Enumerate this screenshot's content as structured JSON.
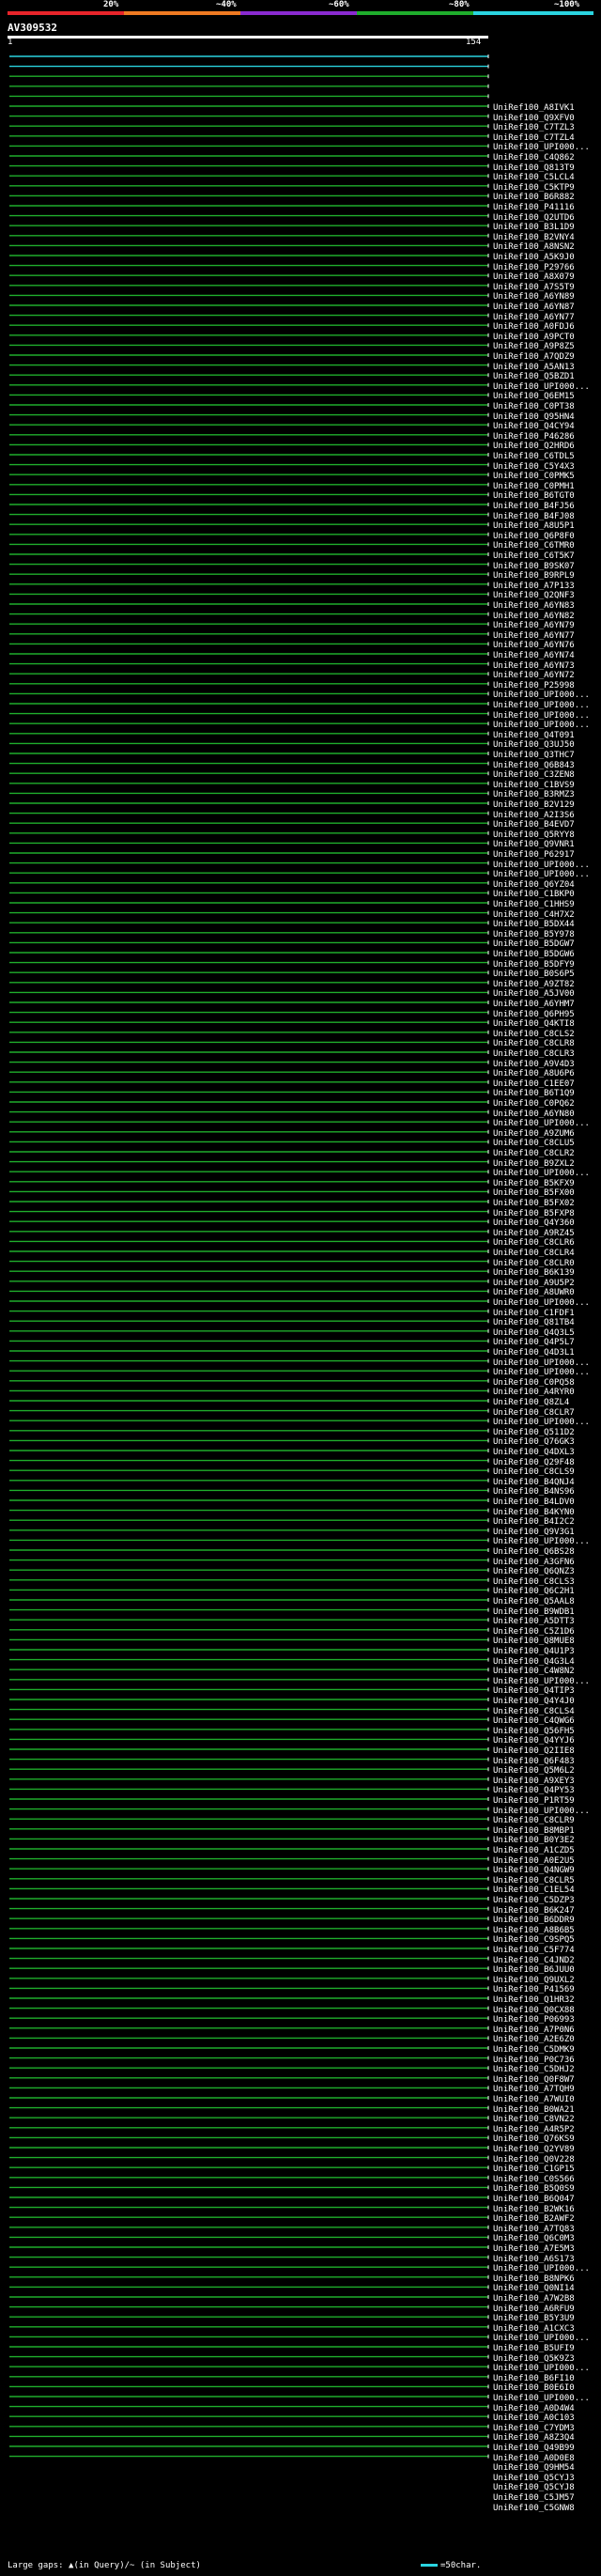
{
  "identity_scale": {
    "labels": [
      "20%",
      "~40%",
      "~60%",
      "~80%",
      "~100%"
    ],
    "colors": [
      "#e8242a",
      "#f07a22",
      "#8a2ad0",
      "#1fae2c",
      "#2ad4e0"
    ]
  },
  "query": {
    "name": "AV309532",
    "start": "1",
    "end": "154"
  },
  "hits": [
    "UniRef100_A8IVK1",
    "UniRef100_Q9XFV0",
    "UniRef100_C7TZL3",
    "UniRef100_C7TZL4",
    "UniRef100_UPI000...",
    "UniRef100_C4Q862",
    "UniRef100_Q813T9",
    "UniRef100_C5LCL4",
    "UniRef100_C5KTP9",
    "UniRef100_B6R882",
    "UniRef100_P41116",
    "UniRef100_Q2UTD6",
    "UniRef100_B3L1D9",
    "UniRef100_B2VNY4",
    "UniRef100_A8NSN2",
    "UniRef100_A5K9J0",
    "UniRef100_P29766",
    "UniRef100_A8X079",
    "UniRef100_A7S5T9",
    "UniRef100_A6YN89",
    "UniRef100_A6YN87",
    "UniRef100_A6YN77",
    "UniRef100_A0FDJ6",
    "UniRef100_A9PCT0",
    "UniRef100_A9P8Z5",
    "UniRef100_A7QDZ9",
    "UniRef100_A5AN13",
    "UniRef100_Q5BZD1",
    "UniRef100_UPI000...",
    "UniRef100_Q6EM15",
    "UniRef100_C0PT38",
    "UniRef100_Q95HN4",
    "UniRef100_Q4CY94",
    "UniRef100_P46286",
    "UniRef100_Q2HRD6",
    "UniRef100_C6TDL5",
    "UniRef100_C5Y4X3",
    "UniRef100_C0PMK5",
    "UniRef100_C0PMH1",
    "UniRef100_B6TGT0",
    "UniRef100_B4FJ56",
    "UniRef100_B4FJ08",
    "UniRef100_A8U5P1",
    "UniRef100_Q6P8F0",
    "UniRef100_C6TMR0",
    "UniRef100_C6T5K7",
    "UniRef100_B9SK07",
    "UniRef100_B9RPL9",
    "UniRef100_A7P133",
    "UniRef100_Q2QNF3",
    "UniRef100_A6YN83",
    "UniRef100_A6YN82",
    "UniRef100_A6YN79",
    "UniRef100_A6YN77",
    "UniRef100_A6YN76",
    "UniRef100_A6YN74",
    "UniRef100_A6YN73",
    "UniRef100_A6YN72",
    "UniRef100_P25998",
    "UniRef100_UPI000...",
    "UniRef100_UPI000...",
    "UniRef100_UPI000...",
    "UniRef100_UPI000...",
    "UniRef100_Q4T091",
    "UniRef100_Q3UJ50",
    "UniRef100_Q3THC7",
    "UniRef100_Q6B843",
    "UniRef100_C3ZEN8",
    "UniRef100_C1BVS9",
    "UniRef100_B3RMZ3",
    "UniRef100_B2V129",
    "UniRef100_A2I3S6",
    "UniRef100_B4EVD7",
    "UniRef100_Q5RYY8",
    "UniRef100_Q9VNR1",
    "UniRef100_P62917",
    "UniRef100_UPI000...",
    "UniRef100_UPI000...",
    "UniRef100_Q6YZ04",
    "UniRef100_C1BKP0",
    "UniRef100_C1HHS9",
    "UniRef100_C4H7X2",
    "UniRef100_B5DX44",
    "UniRef100_B5Y978",
    "UniRef100_B5DGW7",
    "UniRef100_B5DGW6",
    "UniRef100_B5DFY9",
    "UniRef100_B0S6P5",
    "UniRef100_A9ZT82",
    "UniRef100_A5JV00",
    "UniRef100_A6YHM7",
    "UniRef100_Q6PH95",
    "UniRef100_Q4KTI8",
    "UniRef100_C8CLS2",
    "UniRef100_C8CLR8",
    "UniRef100_C8CLR3",
    "UniRef100_A9V4D3",
    "UniRef100_A8U6P6",
    "UniRef100_C1EE07",
    "UniRef100_B6T1Q9",
    "UniRef100_C0PQ62",
    "UniRef100_A6YN80",
    "UniRef100_UPI000...",
    "UniRef100_A9ZUM6",
    "UniRef100_C8CLU5",
    "UniRef100_C8CLR2",
    "UniRef100_B9ZXL2",
    "UniRef100_UPI000...",
    "UniRef100_B5KFX9",
    "UniRef100_B5FX00",
    "UniRef100_B5FX02",
    "UniRef100_B5FXP8",
    "UniRef100_Q4Y360",
    "UniRef100_A9RZ45",
    "UniRef100_C8CLR6",
    "UniRef100_C8CLR4",
    "UniRef100_C8CLR0",
    "UniRef100_B6K139",
    "UniRef100_A9U5P2",
    "UniRef100_A8UWR0",
    "UniRef100_UPI000...",
    "UniRef100_C1FDF1",
    "UniRef100_Q81TB4",
    "UniRef100_Q4Q3L5",
    "UniRef100_Q4P5L7",
    "UniRef100_Q4D3L1",
    "UniRef100_UPI000...",
    "UniRef100_UPI000...",
    "UniRef100_C0PQ58",
    "UniRef100_A4RYR0",
    "UniRef100_Q8ZL4",
    "UniRef100_C8CLR7",
    "UniRef100_UPI000...",
    "UniRef100_Q511D2",
    "UniRef100_Q76GK3",
    "UniRef100_Q4DXL3",
    "UniRef100_Q29F48",
    "UniRef100_C8CLS9",
    "UniRef100_B4QNJ4",
    "UniRef100_B4NS96",
    "UniRef100_B4LDV0",
    "UniRef100_B4KYN0",
    "UniRef100_B4I2C2",
    "UniRef100_Q9V3G1",
    "UniRef100_UPI000...",
    "UniRef100_Q6BS28",
    "UniRef100_A3GFN6",
    "UniRef100_Q6QNZ3",
    "UniRef100_C8CLS3",
    "UniRef100_Q6C2H1",
    "UniRef100_Q5AAL8",
    "UniRef100_B9WDB1",
    "UniRef100_A5DTT3",
    "UniRef100_C5Z1D6",
    "UniRef100_Q8MUE8",
    "UniRef100_Q4U1P3",
    "UniRef100_Q4G3L4",
    "UniRef100_C4W8N2",
    "UniRef100_UPI000...",
    "UniRef100_Q4TIP3",
    "UniRef100_Q4Y4J0",
    "UniRef100_C8CLS4",
    "UniRef100_C4QWG6",
    "UniRef100_Q56FH5",
    "UniRef100_Q4YYJ6",
    "UniRef100_Q2IIE8",
    "UniRef100_Q6F483",
    "UniRef100_Q5M6L2",
    "UniRef100_A9XEY3",
    "UniRef100_Q4PY53",
    "UniRef100_P1RT59",
    "UniRef100_UPI000...",
    "UniRef100_C8CLR9",
    "UniRef100_B8MBP1",
    "UniRef100_B0Y3E2",
    "UniRef100_A1CZD5",
    "UniRef100_A0E2U5",
    "UniRef100_Q4NGW9",
    "UniRef100_C8CLR5",
    "UniRef100_C1EL54",
    "UniRef100_C5DZP3",
    "UniRef100_B6K247",
    "UniRef100_B6DDR9",
    "UniRef100_A8B6B5",
    "UniRef100_C9SPQ5",
    "UniRef100_C5F774",
    "UniRef100_C4JND2",
    "UniRef100_B6JUU0",
    "UniRef100_Q9UXL2",
    "UniRef100_P41569",
    "UniRef100_Q1HR32",
    "UniRef100_Q0CX88",
    "UniRef100_P06993",
    "UniRef100_A7P0N6",
    "UniRef100_A2E6Z0",
    "UniRef100_C5DMK9",
    "UniRef100_P0C736",
    "UniRef100_C5DHJ2",
    "UniRef100_Q0F8W7",
    "UniRef100_A7TQH9",
    "UniRef100_A7WUI0",
    "UniRef100_B0WA21",
    "UniRef100_C8VN22",
    "UniRef100_A4R5P2",
    "UniRef100_Q76KS9",
    "UniRef100_Q2YV89",
    "UniRef100_Q0V228",
    "UniRef100_C1GP15",
    "UniRef100_C0S566",
    "UniRef100_B5Q0S9",
    "UniRef100_B6Q047",
    "UniRef100_B2WK16",
    "UniRef100_B2AWF2",
    "UniRef100_A7TQ83",
    "UniRef100_Q6C0M3",
    "UniRef100_A7E5M3",
    "UniRef100_A6S173",
    "UniRef100_UPI000...",
    "UniRef100_B8NPK6",
    "UniRef100_Q0NI14",
    "UniRef100_A7W2B8",
    "UniRef100_A6RFU9",
    "UniRef100_B5Y3U9",
    "UniRef100_A1CXC3",
    "UniRef100_UPI000...",
    "UniRef100_B5UFI9",
    "UniRef100_Q5K9Z3",
    "UniRef100_UPI000...",
    "UniRef100_B6FI10",
    "UniRef100_B0E6I0",
    "UniRef100_UPI000...",
    "UniRef100_A0D4W4",
    "UniRef100_A0C103",
    "UniRef100_C7YDM3",
    "UniRef100_A8Z3Q4",
    "UniRef100_Q49B99",
    "UniRef100_A0D0E8",
    "UniRef100_Q9HM54",
    "UniRef100_Q5CYJ3",
    "UniRef100_Q5CYJ8",
    "UniRef100_C5JM57",
    "UniRef100_C5GNW8"
  ],
  "footer": {
    "legend": "Large gaps: ▲(in Query)/~ (in Subject)",
    "scale_label": "=50char."
  }
}
